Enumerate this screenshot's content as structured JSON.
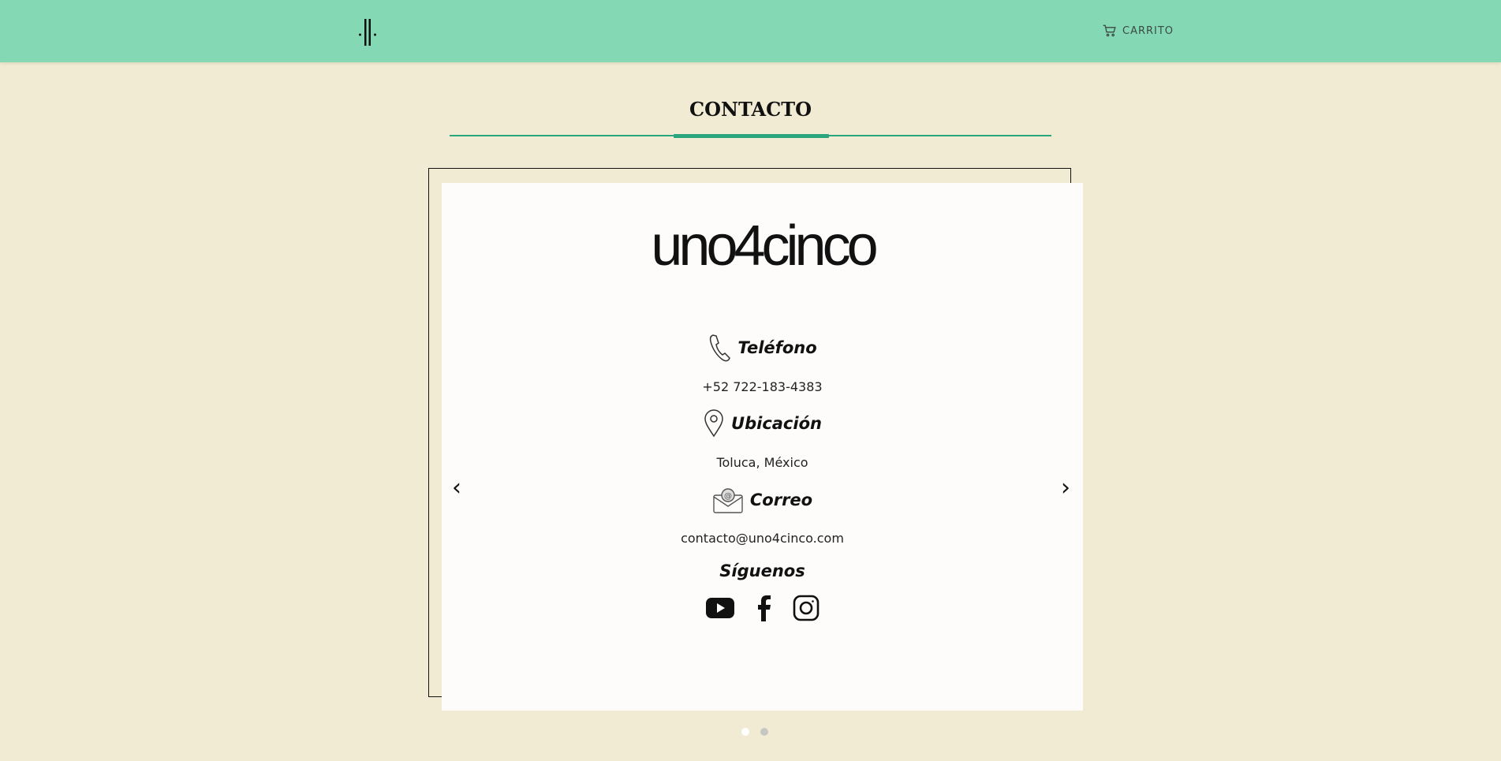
{
  "header": {
    "logo_icon": "vertical-bars-logo",
    "cart_icon": "shopping-cart-icon",
    "cart_label": "CARRITO"
  },
  "page": {
    "title": "CONTACTO"
  },
  "card": {
    "brand_logo_text": "uno4cinco",
    "phone": {
      "icon": "phone-icon",
      "heading": "Teléfono",
      "value": "+52 722-183-4383"
    },
    "location": {
      "icon": "location-pin-icon",
      "heading": "Ubicación",
      "value": "Toluca, México"
    },
    "email": {
      "icon": "envelope-icon",
      "heading": "Correo",
      "value": "contacto@uno4cinco.com"
    },
    "social": {
      "heading": "Síguenos",
      "networks": [
        "youtube-icon",
        "facebook-icon",
        "instagram-icon"
      ]
    }
  },
  "carousel": {
    "prev": "‹",
    "next": "›",
    "slides": 2,
    "active_slide": 1
  },
  "colors": {
    "header_bg": "#84d8b4",
    "page_bg": "#f2ebd3",
    "accent": "#2aa67e",
    "card_bg": "#fdfcfa"
  }
}
